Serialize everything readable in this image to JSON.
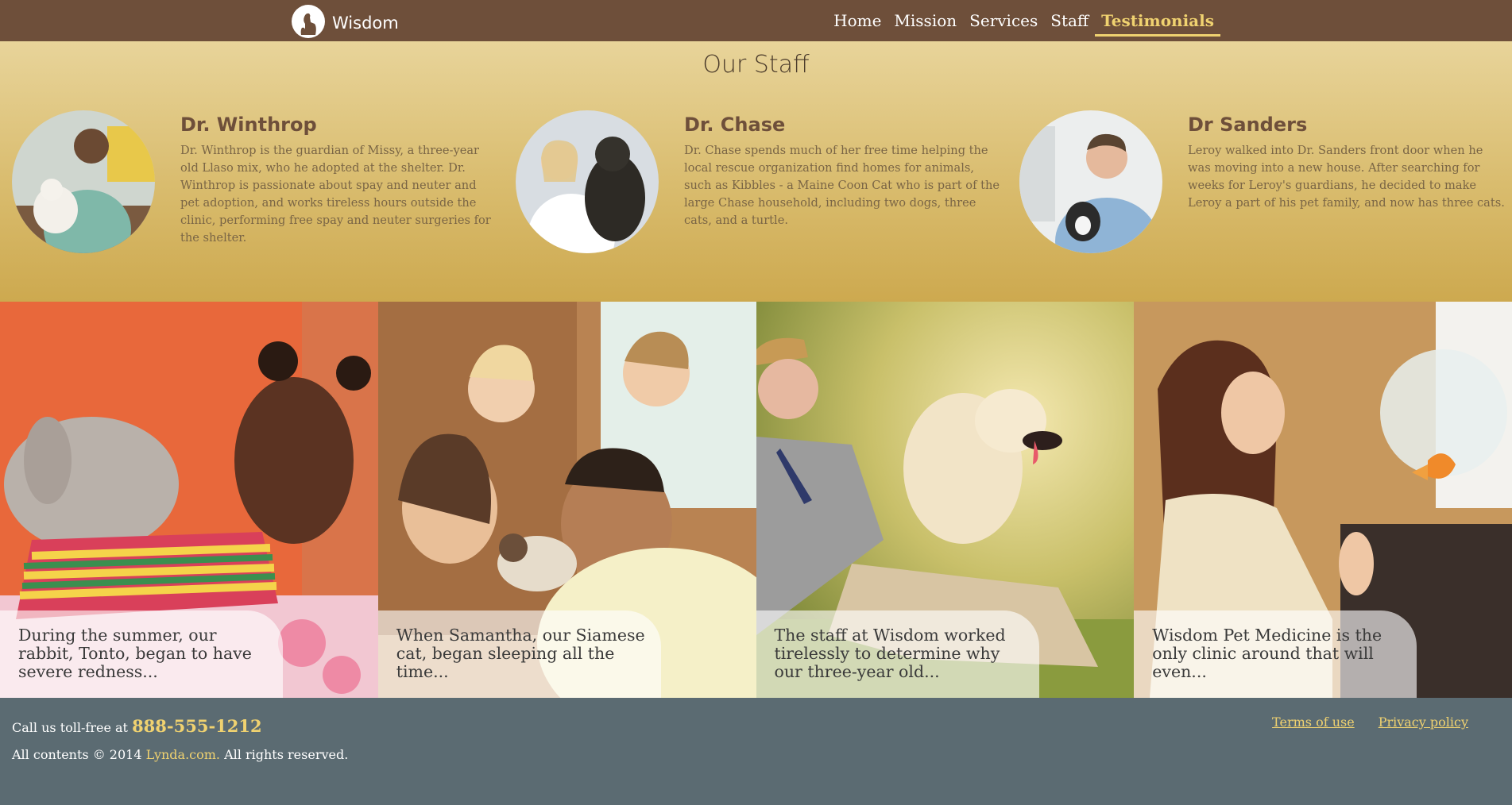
{
  "brand": {
    "name": "Wisdom"
  },
  "nav": {
    "items": [
      {
        "label": "Home"
      },
      {
        "label": "Mission"
      },
      {
        "label": "Services"
      },
      {
        "label": "Staff"
      },
      {
        "label": "Testimonials",
        "active": true
      }
    ]
  },
  "staff": {
    "title": "Our Staff",
    "doctors": [
      {
        "name": "Dr. Winthrop",
        "bio": "Dr. Winthrop is the guardian of Missy, a three-year old Llaso mix, who he adopted at the shelter. Dr. Winthrop is passionate about spay and neuter and pet adoption, and works tireless hours outside the clinic, performing free spay and neuter surgeries for the shelter."
      },
      {
        "name": "Dr. Chase",
        "bio": "Dr. Chase spends much of her free time helping the local rescue organization find homes for animals, such as Kibbles - a Maine Coon Cat who is part of the large Chase household, including two dogs, three cats, and a turtle."
      },
      {
        "name": "Dr Sanders",
        "bio": "Leroy walked into Dr. Sanders front door when he was moving into a new house. After searching for weeks for Leroy's guardians, he decided to make Leroy a part of his pet family, and now has three cats."
      }
    ]
  },
  "testimonials": [
    {
      "excerpt": "During the summer, our rabbit, Tonto, began to have severe redness..."
    },
    {
      "excerpt": "When Samantha, our Siamese cat, began sleeping all the time..."
    },
    {
      "excerpt": "The staff at Wisdom worked tirelessly to determine why our three-year old..."
    },
    {
      "excerpt": "Wisdom Pet Medicine is the only clinic around that will even..."
    }
  ],
  "footer": {
    "call_prefix": "Call us toll-free at",
    "phone": "888-555-1212",
    "copyright_prefix": "All contents © 2014",
    "copyright_link": "Lynda.com.",
    "copyright_suffix": "All rights reserved.",
    "terms": "Terms of use",
    "privacy": "Privacy policy"
  },
  "colors": {
    "nav_bg": "#6e4f3a",
    "accent": "#f0d270",
    "staff_bg": "#d9bc6e",
    "footer_bg": "#5b6b72"
  }
}
